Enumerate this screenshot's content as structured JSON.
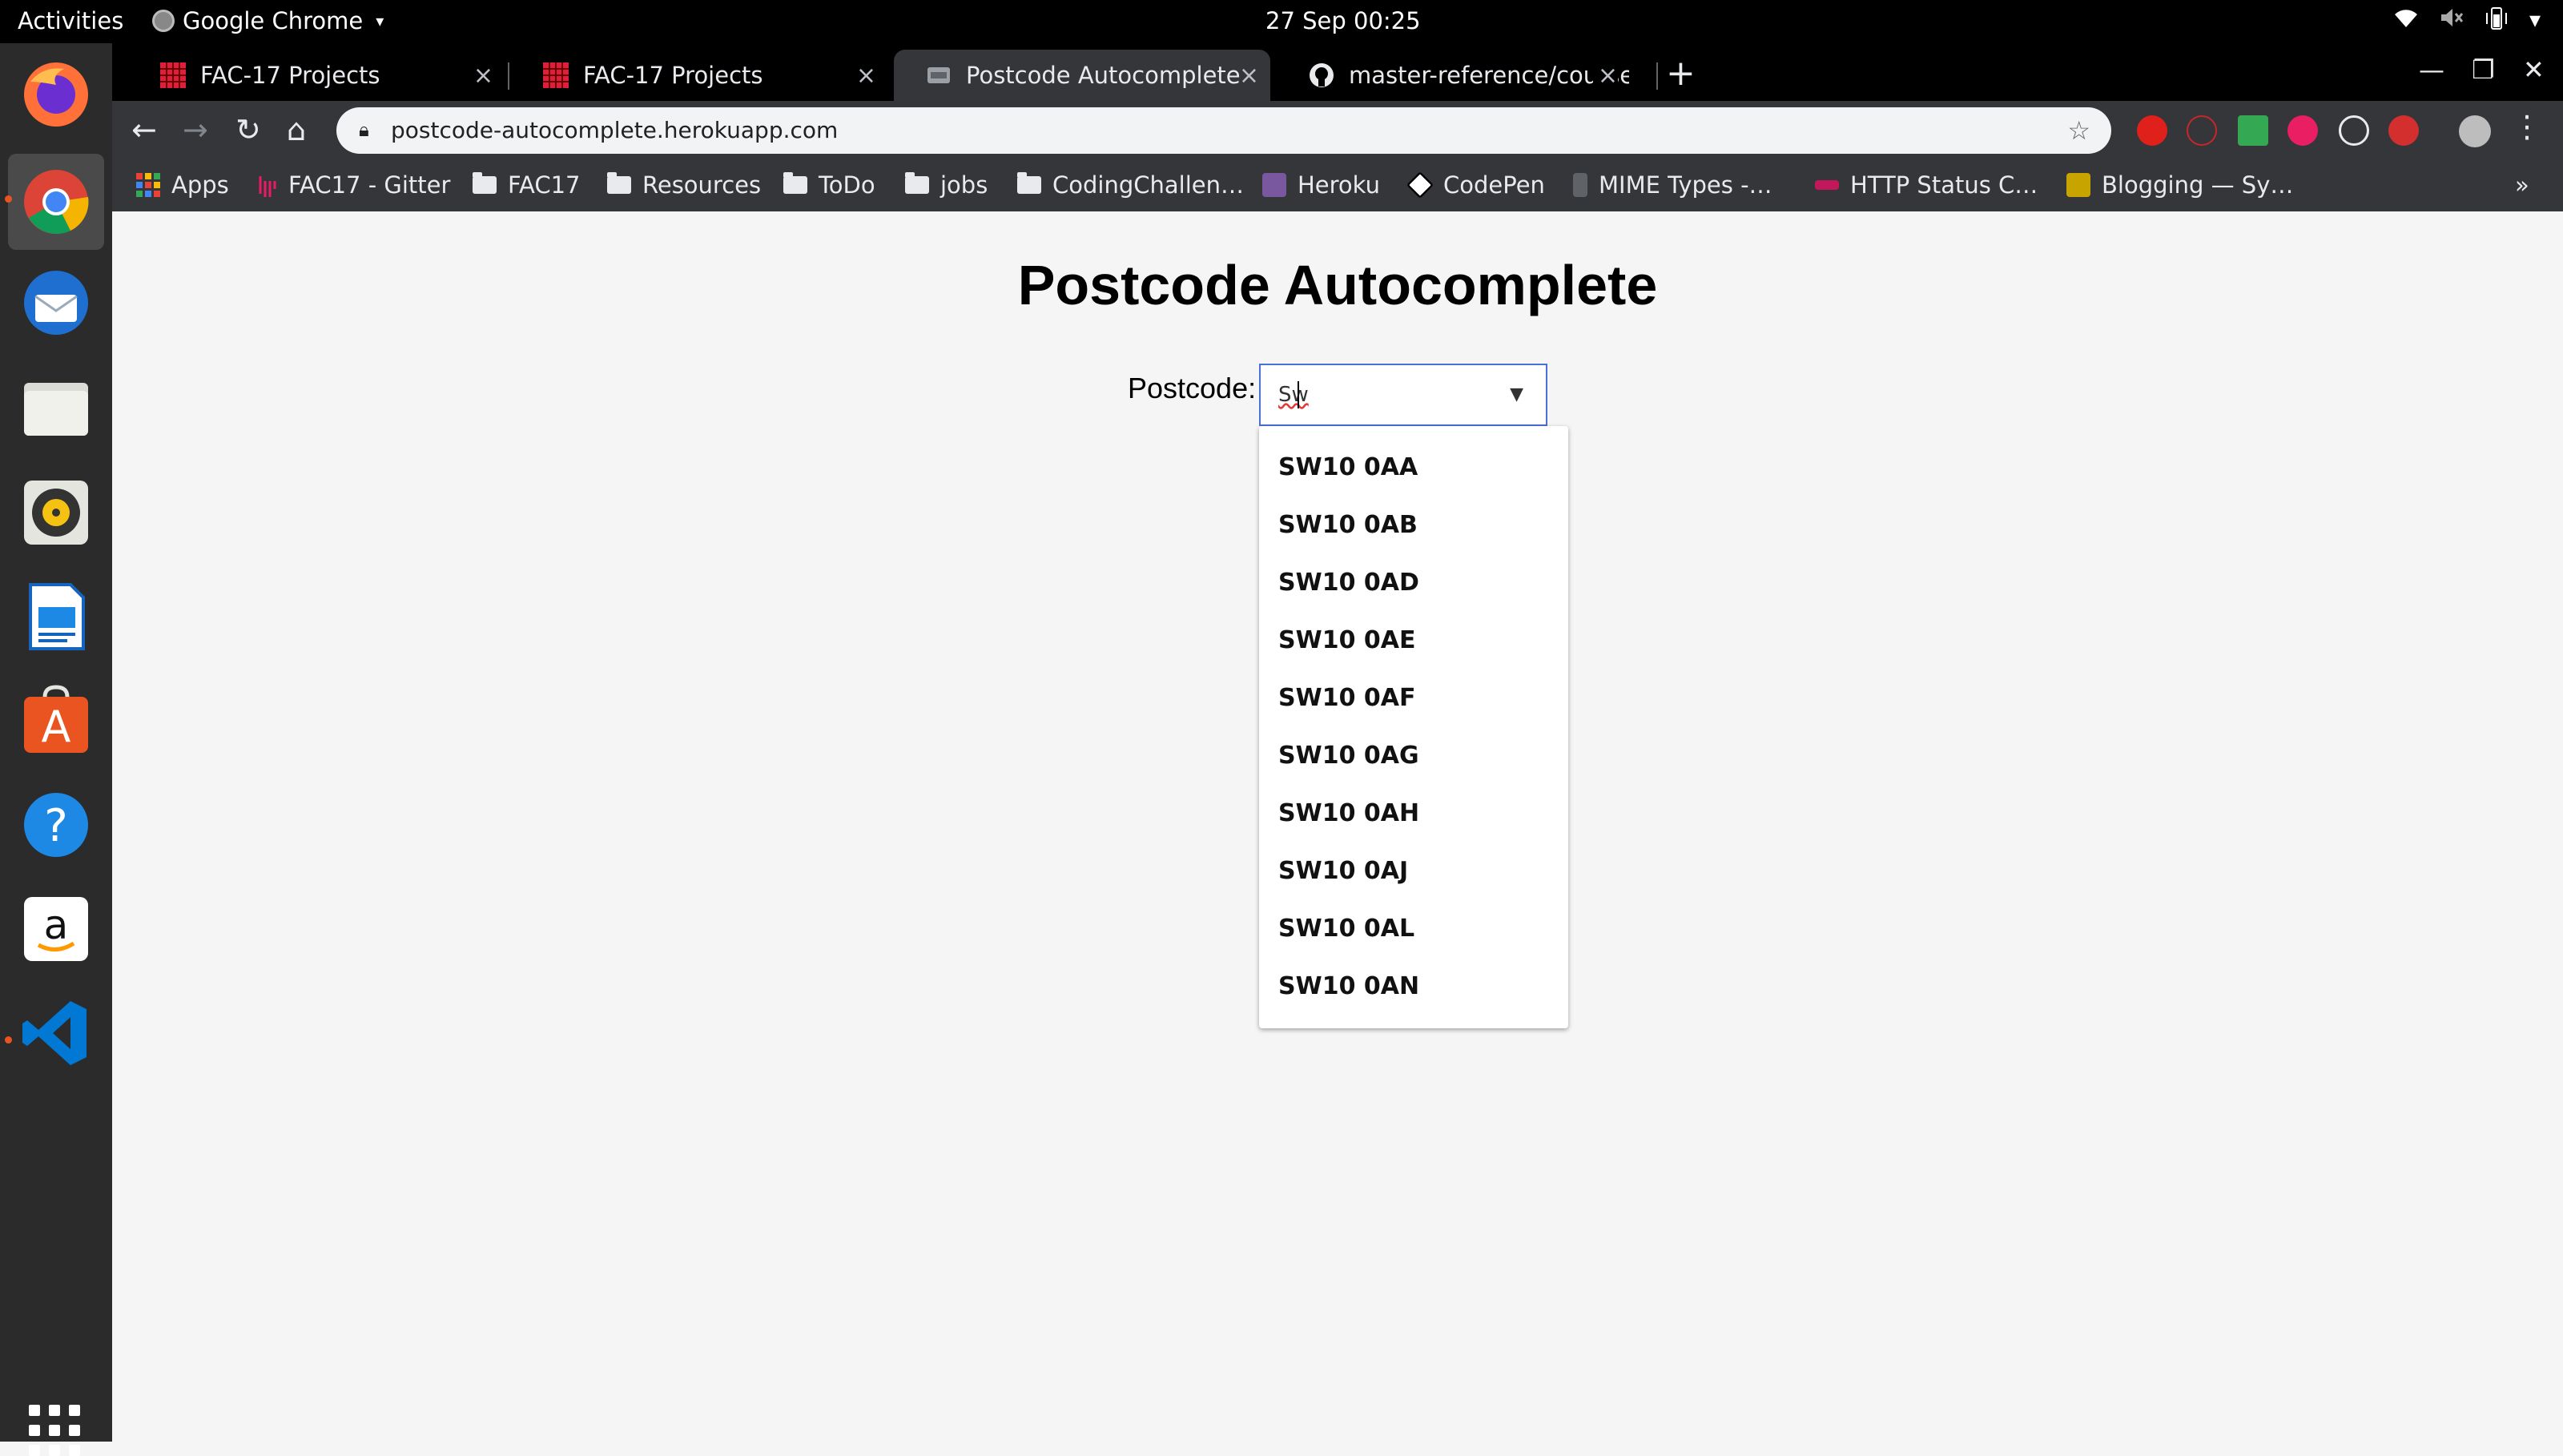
{
  "system": {
    "activities": "Activities",
    "app_name": "Google Chrome",
    "clock": "27 Sep  00:25"
  },
  "browser": {
    "tabs": [
      {
        "title": "FAC-17 Projects"
      },
      {
        "title": "FAC-17 Projects"
      },
      {
        "title": "Postcode Autocomplete"
      },
      {
        "title": "master-reference/courset"
      }
    ],
    "url": "postcode-autocomplete.herokuapp.com",
    "bookmarks": [
      "Apps",
      "FAC17 - Gitter",
      "FAC17",
      "Resources",
      "ToDo",
      "jobs",
      "CodingChallen…",
      "Heroku",
      "CodePen",
      "MIME Types -…",
      "HTTP Status C…",
      "Blogging — Sy…"
    ],
    "more_bookmarks": "»"
  },
  "page": {
    "title": "Postcode Autocomplete",
    "label": "Postcode:",
    "input_value": "Sw",
    "options": [
      "SW10 0AA",
      "SW10 0AB",
      "SW10 0AD",
      "SW10 0AE",
      "SW10 0AF",
      "SW10 0AG",
      "SW10 0AH",
      "SW10 0AJ",
      "SW10 0AL",
      "SW10 0AN"
    ]
  },
  "icons": {
    "close": "×",
    "new_tab": "+",
    "back": "←",
    "forward": "→",
    "reload": "↻",
    "home": "⌂",
    "star": "☆",
    "dropdown_arrow": "▼"
  },
  "colors": {
    "accent_focus": "#4a6fd8",
    "ubuntu_orange": "#e95420"
  }
}
